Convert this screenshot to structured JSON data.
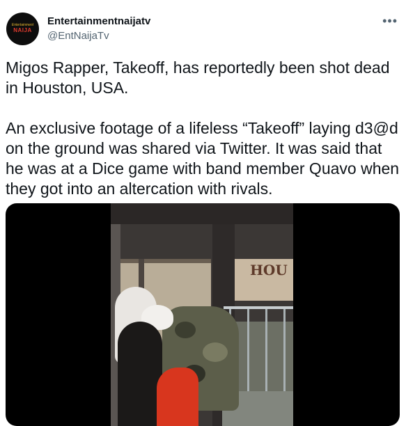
{
  "tweet": {
    "author": {
      "display_name": "Entertainmentnaijatv",
      "handle": "@EntNaijaTv",
      "avatar_top": "Entertainment",
      "avatar_main": "NAIJA"
    },
    "more_icon": "•••",
    "text": {
      "paragraph_1": "Migos Rapper, Takeoff, has reportedly been shot dead in Houston, USA.",
      "paragraph_2": "An exclusive footage of a lifeless “Takeoff” laying d3@d on the ground was shared via Twitter. It was said that he was at a Dice game with band member Quavo when they got into an altercation with rivals."
    },
    "media": {
      "sign_text": "HOU"
    }
  }
}
